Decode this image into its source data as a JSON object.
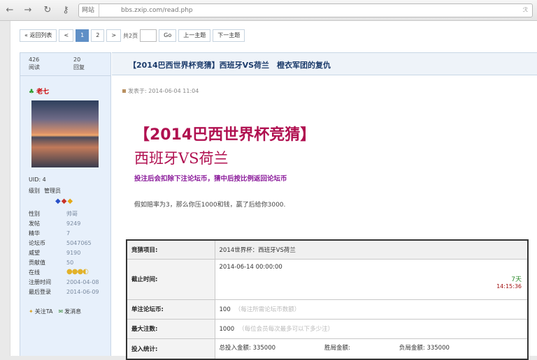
{
  "browser": {
    "back_icon": "back-arrow-icon",
    "forward_icon": "forward-arrow-icon",
    "refresh_icon": "refresh-icon",
    "key_icon": "key-icon",
    "site_label": "网站",
    "url": "bbs.zxip.com/read.php",
    "right_icon": "rss-icon"
  },
  "pager": {
    "back_list": "« 返回列表",
    "prev": "<",
    "page1": "1",
    "page2": "2",
    "next": ">",
    "total": "共2页",
    "go": "Go",
    "prev_topic": "上一主题",
    "next_topic": "下一主题"
  },
  "sidebar": {
    "views_count": "426",
    "views_label": "阅读",
    "replies_count": "20",
    "replies_label": "回复",
    "username": "老七",
    "uid": "UID: 4",
    "group_label": "级别",
    "group_value": "管理员",
    "profile": [
      {
        "key": "性别",
        "value": "帅哥"
      },
      {
        "key": "发帖",
        "value": "9249"
      },
      {
        "key": "精华",
        "value": "7"
      },
      {
        "key": "论坛币",
        "value": "5047065"
      },
      {
        "key": "威望",
        "value": "9190"
      },
      {
        "key": "贡献值",
        "value": "50"
      },
      {
        "key": "在线",
        "value": ""
      },
      {
        "key": "注册时间",
        "value": "2004-04-08"
      },
      {
        "key": "最后登录",
        "value": "2014-06-09"
      }
    ],
    "follow": "关注TA",
    "message": "发消息"
  },
  "post": {
    "thread_title": "【2014巴西世界杯竞猜】西班牙VS荷兰　橙衣军团的复仇",
    "posted_at": "发表于: 2014-06-04 11:04",
    "headline1": "【2014巴西世界杯竞猜】",
    "headline2": "西班牙VS荷兰",
    "subline": "投注后会扣除下注论坛币，猜中后按比例返回论坛币",
    "note": "假如赔率为3，那么你压1000和钱，赢了后给你3000."
  },
  "bet_table": {
    "item_label": "竞猜项目:",
    "item_value": "2014世界杯：西班牙VS荷兰",
    "deadline_label": "截止时间:",
    "deadline_value": "2014-06-14 00:00:00",
    "countdown_days": "7天",
    "countdown_time": "14:15:36",
    "unit_label": "单注论坛币:",
    "unit_value": "100",
    "unit_hint": "（每注所需论坛币数额）",
    "max_label": "最大注数:",
    "max_value": "1000",
    "max_hint": "（每位会员每次最多可以下多少注）",
    "stat_label": "投入统计:",
    "stat_total": "总投入金额: 335000",
    "stat_win": "胜局金额:",
    "stat_lose": "负局金额: 335000"
  }
}
